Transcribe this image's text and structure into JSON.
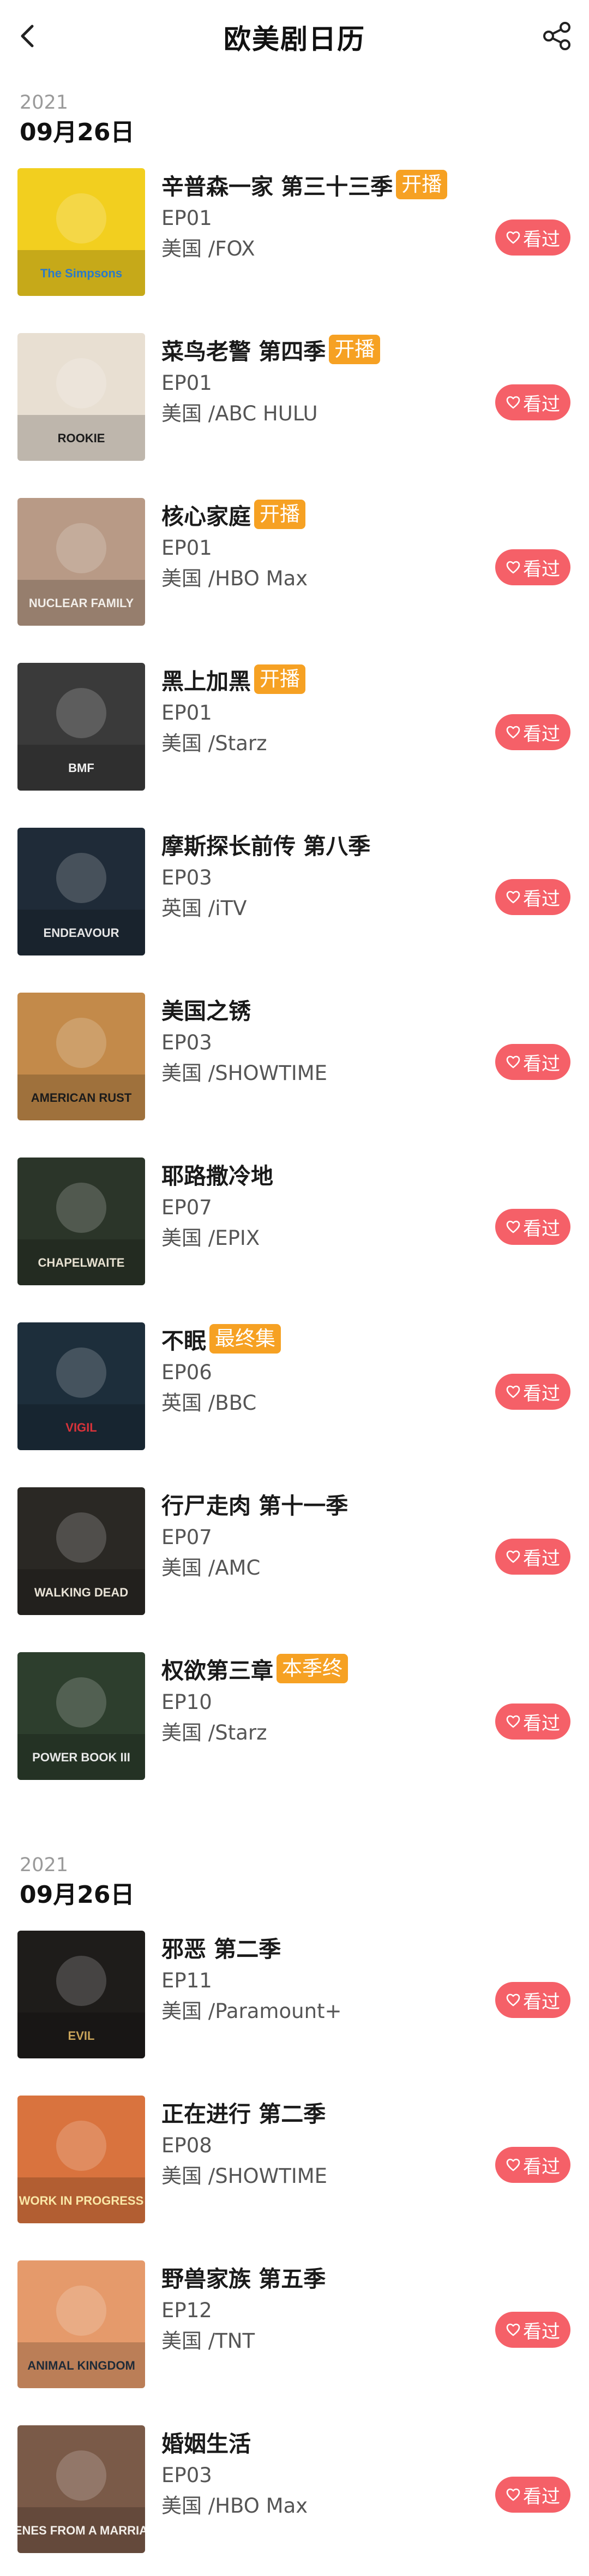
{
  "header": {
    "title": "欧美剧日历"
  },
  "sections": [
    {
      "year": "2021",
      "date": "09月26日",
      "items": [
        {
          "title": "辛普森一家 第三十三季",
          "badge": "开播",
          "episode": "EP01",
          "region": "美国 /FOX",
          "watch": "看过"
        },
        {
          "title": "菜鸟老警 第四季",
          "badge": "开播",
          "episode": "EP01",
          "region": "美国 /ABC HULU",
          "watch": "看过"
        },
        {
          "title": "核心家庭",
          "badge": "开播",
          "episode": "EP01",
          "region": "美国 /HBO Max",
          "watch": "看过"
        },
        {
          "title": "黑上加黑",
          "badge": "开播",
          "episode": "EP01",
          "region": "美国 /Starz",
          "watch": "看过"
        },
        {
          "title": "摩斯探长前传 第八季",
          "badge": "",
          "episode": "EP03",
          "region": "英国 /iTV",
          "watch": "看过"
        },
        {
          "title": "美国之锈",
          "badge": "",
          "episode": "EP03",
          "region": "美国 /SHOWTIME",
          "watch": "看过"
        },
        {
          "title": "耶路撒冷地",
          "badge": "",
          "episode": "EP07",
          "region": "美国 /EPIX",
          "watch": "看过"
        },
        {
          "title": "不眠",
          "badge": "最终集",
          "episode": "EP06",
          "region": "英国 /BBC",
          "watch": "看过"
        },
        {
          "title": "行尸走肉 第十一季",
          "badge": "",
          "episode": "EP07",
          "region": "美国 /AMC",
          "watch": "看过"
        },
        {
          "title": "权欲第三章",
          "badge": "本季终",
          "episode": "EP10",
          "region": "美国 /Starz",
          "watch": "看过"
        }
      ]
    },
    {
      "year": "2021",
      "date": "09月26日",
      "items": [
        {
          "title": "邪恶 第二季",
          "badge": "",
          "episode": "EP11",
          "region": "美国 /Paramount+",
          "watch": "看过"
        },
        {
          "title": "正在进行 第二季",
          "badge": "",
          "episode": "EP08",
          "region": "美国 /SHOWTIME",
          "watch": "看过"
        },
        {
          "title": "野兽家族 第五季",
          "badge": "",
          "episode": "EP12",
          "region": "美国 /TNT",
          "watch": "看过"
        },
        {
          "title": "婚姻生活",
          "badge": "",
          "episode": "EP03",
          "region": "美国 /HBO Max",
          "watch": "看过"
        }
      ]
    }
  ],
  "posters": [
    {
      "text": "The Simpsons",
      "bg": "#f2cf1f",
      "fg": "#2a7ac9"
    },
    {
      "text": "ROOKIE",
      "bg": "#e8dfd2",
      "fg": "#1b1b1b"
    },
    {
      "text": "NUCLEAR FAMILY",
      "bg": "#b89a86",
      "fg": "#f2eee9"
    },
    {
      "text": "BMF",
      "bg": "#3a3a3a",
      "fg": "#f0f0f0"
    },
    {
      "text": "ENDEAVOUR",
      "bg": "#1f2b38",
      "fg": "#e6e6e6"
    },
    {
      "text": "AMERICAN RUST",
      "bg": "#c38a4a",
      "fg": "#1b1b1b"
    },
    {
      "text": "CHAPELWAITE",
      "bg": "#2b3529",
      "fg": "#e7e1d1"
    },
    {
      "text": "VIGIL",
      "bg": "#1d2e3b",
      "fg": "#d9333a"
    },
    {
      "text": "WALKING DEAD",
      "bg": "#2a2824",
      "fg": "#e8e2d6"
    },
    {
      "text": "POWER BOOK III",
      "bg": "#2d3e2d",
      "fg": "#e8e8e8"
    },
    {
      "text": "EVIL",
      "bg": "#1e1c1a",
      "fg": "#c9a45a"
    },
    {
      "text": "WORK IN PROGRESS",
      "bg": "#d9733e",
      "fg": "#f9e7a7"
    },
    {
      "text": "ANIMAL KINGDOM",
      "bg": "#e59a6b",
      "fg": "#1f2b38"
    },
    {
      "text": "SCENES FROM A MARRIAGE",
      "bg": "#7a5a48",
      "fg": "#f2eee9"
    }
  ]
}
